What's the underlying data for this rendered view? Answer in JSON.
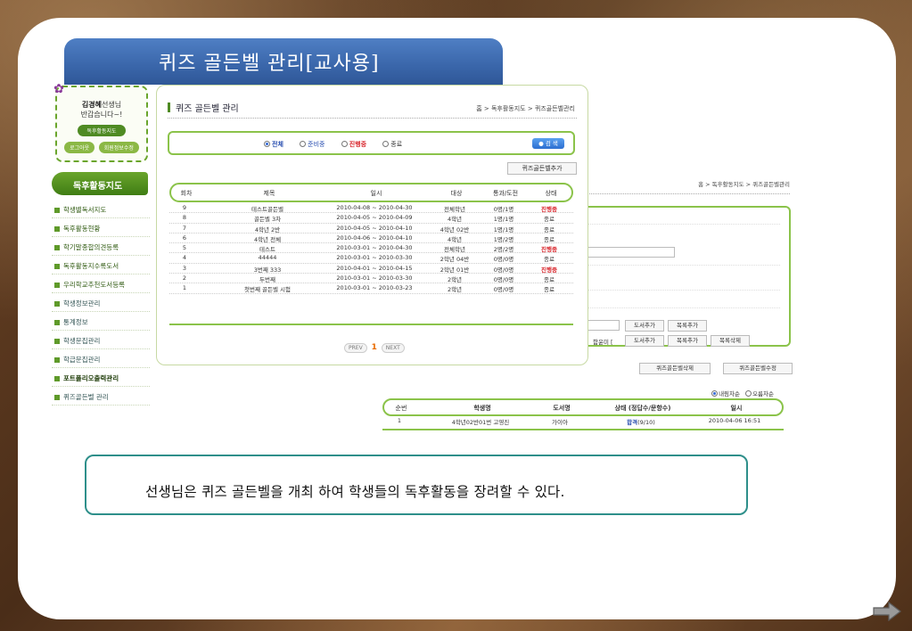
{
  "slide_title": "퀴즈 골든벨 관리[교사용]",
  "login": {
    "name_bold": "김경혜",
    "name_suffix": "선생님",
    "greeting": "반갑습니다~!",
    "main_button": "독후활동지도",
    "logout": "로그아웃",
    "edit_profile": "회원정보수정"
  },
  "sidebar": {
    "title": "독후활동지도",
    "items": [
      "학생별독서지도",
      "독후활동현황",
      "학기말종합의견등록",
      "독후활동지수록도서",
      "우리학교추천도서등록",
      "학생정보관리",
      "통계정보",
      "학생문집관리",
      "학급문집관리",
      "포트폴리오출력관리",
      "퀴즈골든벨 관리"
    ]
  },
  "main": {
    "title": "퀴즈 골든벨 관리",
    "breadcrumb": "홈 > 독후활동지도 > 퀴즈골든벨관리",
    "filters": [
      "전체",
      "준비중",
      "진행중",
      "종료"
    ],
    "search_button": "검 색",
    "add_button": "퀴즈골든벨추가",
    "columns": [
      "회차",
      "제목",
      "일시",
      "대상",
      "통과/도전",
      "상태"
    ],
    "rows": [
      [
        "9",
        "테스트골든벨",
        "2010-04-08 ~ 2010-04-30",
        "전체학년",
        "0명/1명",
        "진행중"
      ],
      [
        "8",
        "골든벨 3차",
        "2010-04-05 ~ 2010-04-09",
        "4학년",
        "1명/1명",
        "종료"
      ],
      [
        "7",
        "4학년 2반",
        "2010-04-05 ~ 2010-04-10",
        "4학년 02반",
        "1명/1명",
        "종료"
      ],
      [
        "6",
        "4학년 전체",
        "2010-04-06 ~ 2010-04-10",
        "4학년",
        "1명/2명",
        "종료"
      ],
      [
        "5",
        "테스트",
        "2010-03-01 ~ 2010-04-30",
        "전체학년",
        "2명/2명",
        "진행중"
      ],
      [
        "4",
        "44444",
        "2010-03-01 ~ 2010-03-30",
        "2학년 04반",
        "0명/0명",
        "종료"
      ],
      [
        "3",
        "3번째 333",
        "2010-04-01 ~ 2010-04-15",
        "2학년 01반",
        "0명/0명",
        "진행중"
      ],
      [
        "2",
        "두번째",
        "2010-03-01 ~ 2010-03-30",
        "2학년",
        "0명/0명",
        "종료"
      ],
      [
        "1",
        "첫번째 골든벨 시험",
        "2010-03-01 ~ 2010-03-23",
        "2학년",
        "0명/0명",
        "종료"
      ]
    ],
    "pager": {
      "prev": "PREV",
      "page": "1",
      "next": "NEXT"
    }
  },
  "back": {
    "breadcrumb": "홈 > 독후활동지도 > 퀴즈골든벨관리",
    "book_add_1": "도서추가",
    "list_add_1": "목록추가",
    "partial_label": "함윤미 [",
    "book_add_2": "도서추가",
    "list_add_2": "목록추가",
    "list_delete": "목록삭제",
    "delete_button": "퀴즈골든벨삭제",
    "edit_button": "퀴즈골든벨수정",
    "order_desc": "내림차순",
    "order_asc": "오름차순",
    "columns": [
      "순번",
      "학생명",
      "도서명",
      "상태 (정답수/문항수)",
      "일시"
    ],
    "row": [
      "1",
      "4학년02반01번 고영진",
      "가이아",
      "합격",
      "(9/10)",
      "2010-04-06 16:51"
    ]
  },
  "caption": "선생님은 퀴즈 골든벨을 개최 하여 학생들의 독후활동을 장려할 수 있다.",
  "colors": {
    "accent_green": "#8bc34a",
    "banner_blue": "#3a66aa",
    "status_red": "#d8262c",
    "caption_border": "#2e8f8a"
  }
}
